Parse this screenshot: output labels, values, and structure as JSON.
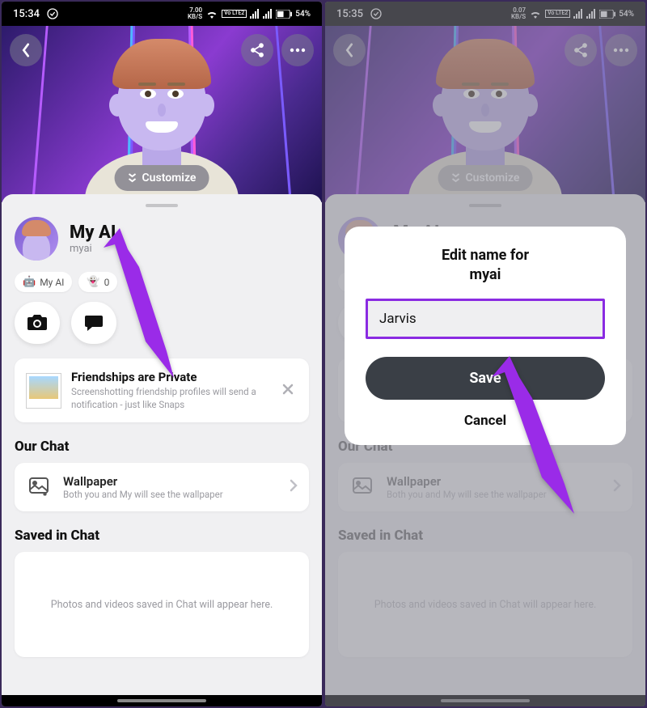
{
  "status": {
    "left": {
      "time": "15:34",
      "time_r": "15:35"
    },
    "right": {
      "kbs1": "7.00",
      "kbs1u": "KB/S",
      "kbs2": "0.07",
      "kbs2u": "KB/S",
      "lte": "Vo LTE2",
      "battery": "54%"
    }
  },
  "hero": {
    "customize": "Customize"
  },
  "profile": {
    "name": "My AI",
    "username": "myai",
    "chip_ai": "My AI",
    "chip_count": "0"
  },
  "privacy": {
    "title": "Friendships are Private",
    "sub": "Screenshotting friendship profiles will send a notification - just like Snaps"
  },
  "sections": {
    "chat": "Our Chat",
    "saved": "Saved in Chat"
  },
  "wallpaper": {
    "title": "Wallpaper",
    "sub": "Both you and My will see the wallpaper"
  },
  "saved_empty": "Photos and videos saved in Chat will appear here.",
  "modal": {
    "title_line1": "Edit name for",
    "title_line2": "myai",
    "input_value": "Jarvis",
    "save": "Save",
    "cancel": "Cancel"
  }
}
